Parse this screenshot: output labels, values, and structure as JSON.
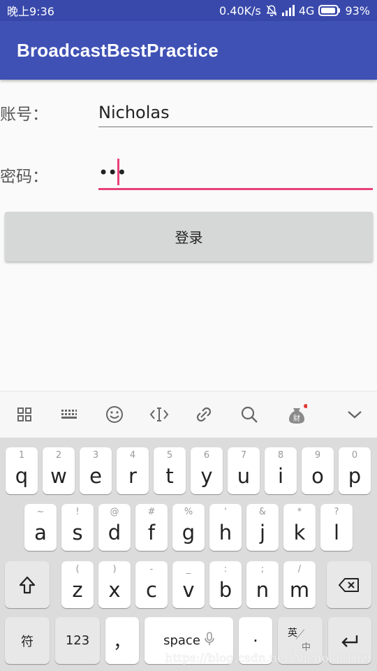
{
  "status_bar": {
    "time": "晚上9:36",
    "speed": "0.40K/s",
    "network": "4G",
    "battery": "93%"
  },
  "app_bar": {
    "title": "BroadcastBestPractice"
  },
  "form": {
    "account_label": "账号：",
    "account_value": "Nicholas",
    "password_label": "密码：",
    "password_masked": "•••",
    "login_button": "登录"
  },
  "keyboard": {
    "row1": [
      {
        "hint": "1",
        "key": "q"
      },
      {
        "hint": "2",
        "key": "w"
      },
      {
        "hint": "3",
        "key": "e"
      },
      {
        "hint": "4",
        "key": "r"
      },
      {
        "hint": "5",
        "key": "t"
      },
      {
        "hint": "6",
        "key": "y"
      },
      {
        "hint": "7",
        "key": "u"
      },
      {
        "hint": "8",
        "key": "i"
      },
      {
        "hint": "9",
        "key": "o"
      },
      {
        "hint": "0",
        "key": "p"
      }
    ],
    "row2": [
      {
        "hint": "~",
        "key": "a"
      },
      {
        "hint": "!",
        "key": "s"
      },
      {
        "hint": "@",
        "key": "d"
      },
      {
        "hint": "#",
        "key": "f"
      },
      {
        "hint": "%",
        "key": "g"
      },
      {
        "hint": "'",
        "key": "h"
      },
      {
        "hint": "&",
        "key": "j"
      },
      {
        "hint": "*",
        "key": "k"
      },
      {
        "hint": "?",
        "key": "l"
      }
    ],
    "row3": [
      {
        "hint": "(",
        "key": "z"
      },
      {
        "hint": ")",
        "key": "x"
      },
      {
        "hint": "-",
        "key": "c"
      },
      {
        "hint": "_",
        "key": "v"
      },
      {
        "hint": ":",
        "key": "b"
      },
      {
        "hint": ";",
        "key": "n"
      },
      {
        "hint": "/",
        "key": "m"
      }
    ],
    "symbols_key": "符",
    "numbers_key": "123",
    "comma_key": "，",
    "space_key": "space",
    "period_key": "·",
    "lang_top": "英",
    "lang_bottom": "中"
  },
  "toolbar_icons": [
    "grid-apps-icon",
    "keyboard-icon",
    "emoji-icon",
    "cursor-move-icon",
    "link-icon",
    "search-icon",
    "money-bag-icon",
    "chevron-down-icon"
  ],
  "watermark": "https://blog.csdn.net/Nicholas1hzf",
  "colors": {
    "primary": "#3f51b5",
    "status_bar": "#3949ab",
    "accent": "#e8407a"
  }
}
